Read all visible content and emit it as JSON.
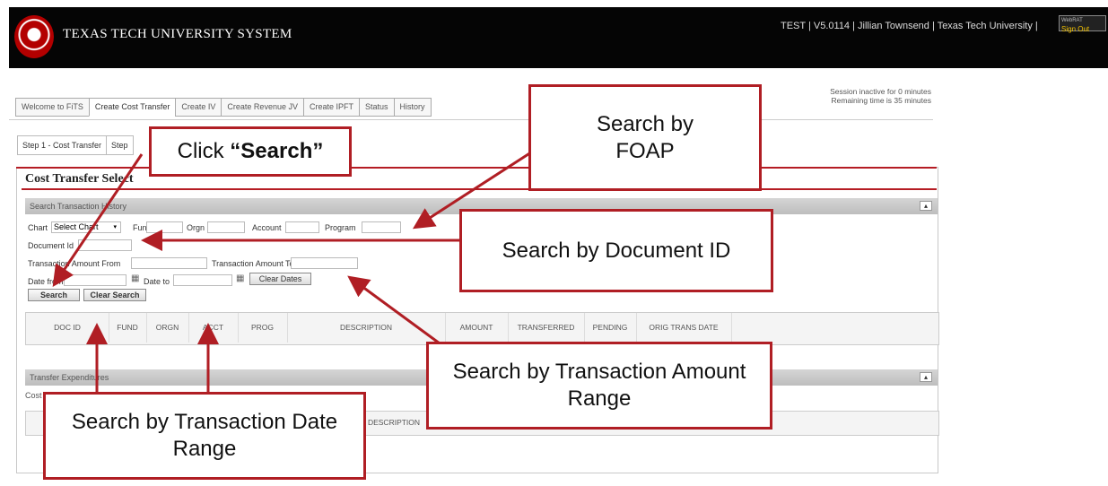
{
  "header": {
    "system_name": "TEXAS TECH UNIVERSITY SYSTEM",
    "user_info": "TEST | V5.0114 | Jillian Townsend | Texas Tech University |",
    "signout_top": "WebRAT",
    "signout_label": "Sign Out"
  },
  "tabs": [
    "Welcome to FiTS",
    "Create Cost Transfer",
    "Create IV",
    "Create Revenue JV",
    "Create IPFT",
    "Status",
    "History"
  ],
  "session": {
    "line1": "Session inactive for 0 minutes",
    "line2": "Remaining time is 35 minutes"
  },
  "steps": [
    "Step 1 - Cost Transfer",
    "Step"
  ],
  "panel": {
    "title": "Cost Transfer Select",
    "search_section": "Search Transaction History",
    "transfer_section": "Transfer Expenditures",
    "transfer_sub": "Cost Transfer Expenditure",
    "collapse": "▴"
  },
  "form": {
    "chart_label": "Chart",
    "chart_value": "Select Chart",
    "fund_label": "Fund",
    "orgn_label": "Orgn",
    "account_label": "Account",
    "program_label": "Program",
    "docid_label": "Document Id",
    "amt_from_label": "Transaction Amount From",
    "amt_to_label": "Transaction Amount To",
    "date_from_label": "Date from",
    "date_to_label": "Date to",
    "clear_dates": "Clear Dates",
    "search": "Search",
    "clear_search": "Clear Search"
  },
  "grid_columns": [
    "DOC ID",
    "FUND",
    "ORGN",
    "ACCT",
    "PROG",
    "DESCRIPTION",
    "AMOUNT",
    "TRANSFERRED",
    "PENDING",
    "ORIG TRANS DATE"
  ],
  "grid2_columns": [
    "DESCRIPTION"
  ],
  "callouts": {
    "click_search_1": "Click ",
    "click_search_2": "“Search”",
    "foap": "Search by FOAP",
    "docid": "Search by Document ID",
    "amount": "Search by Transaction Amount Range",
    "date": "Search by Transaction Date Range"
  },
  "colors": {
    "accent": "#b01e24",
    "header_bg": "#050505"
  }
}
